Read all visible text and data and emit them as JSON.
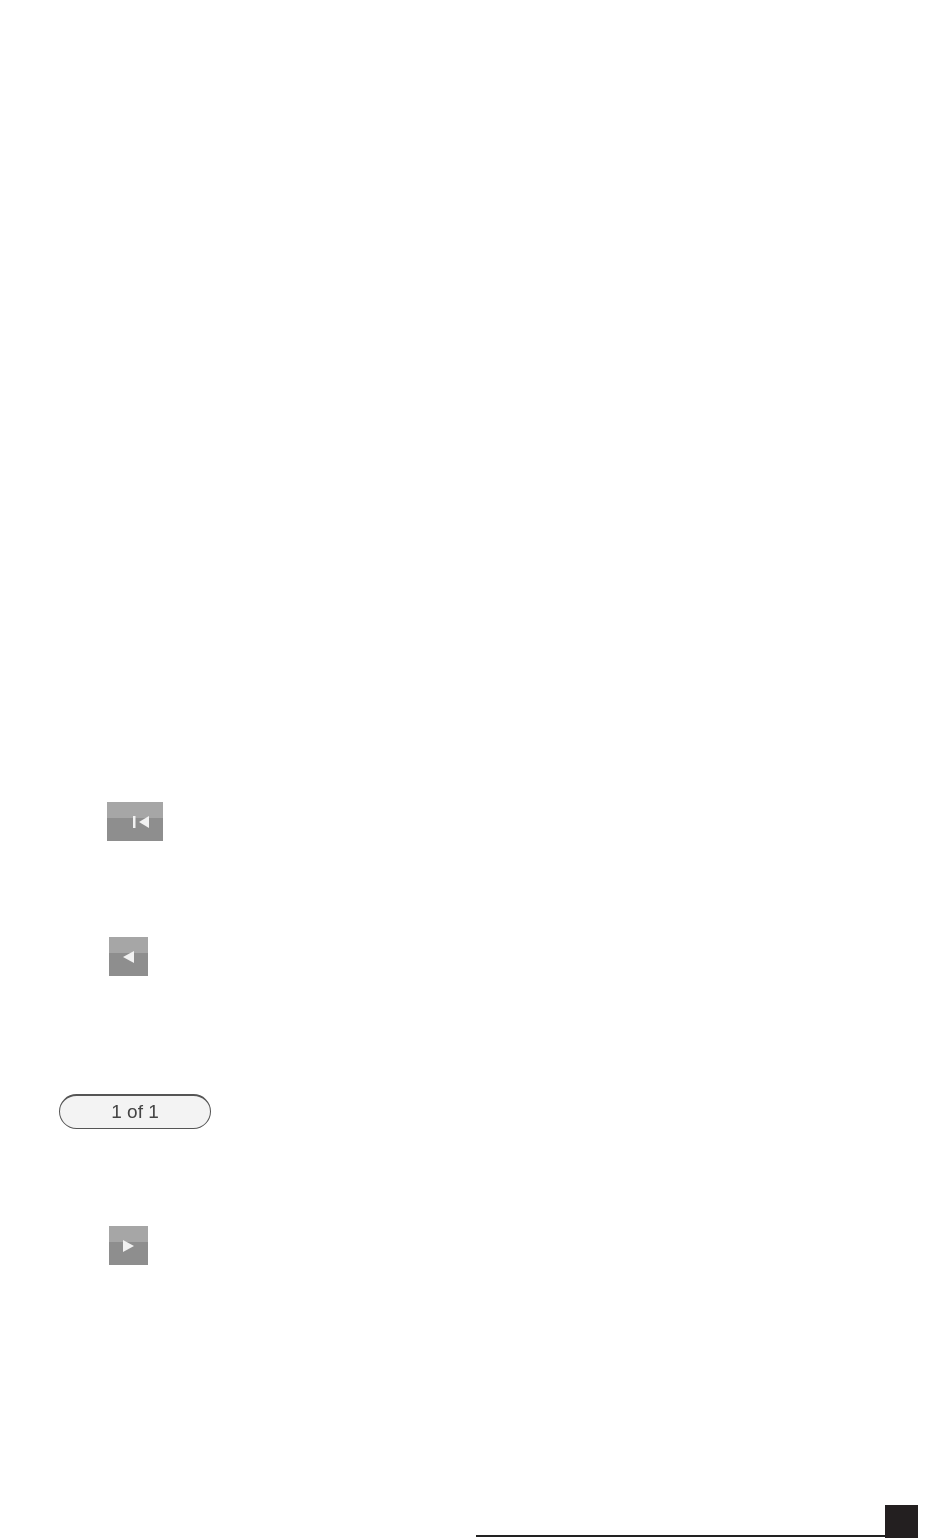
{
  "controls": [
    {
      "kind": "first"
    },
    {
      "kind": "previous"
    },
    {
      "kind": "indicator",
      "text": "1 of 1"
    },
    {
      "kind": "next"
    }
  ]
}
